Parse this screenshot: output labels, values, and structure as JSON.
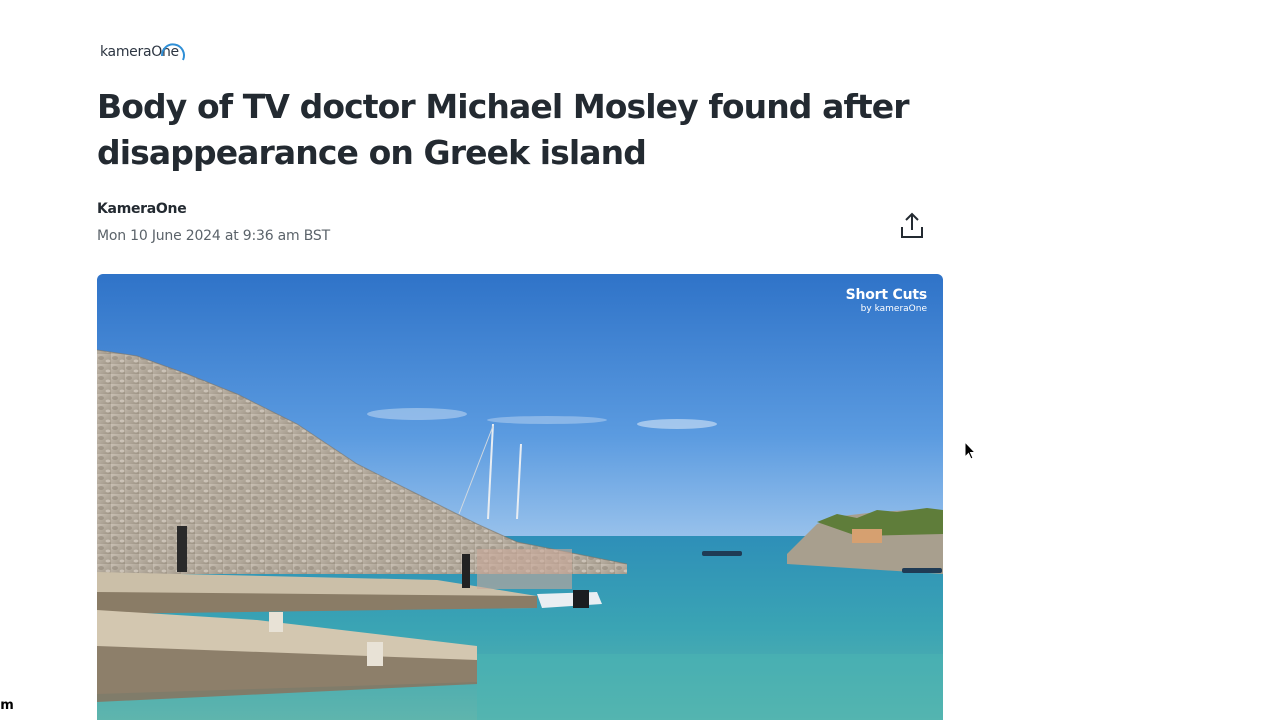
{
  "brand": {
    "logo_text": "kameraOne"
  },
  "article": {
    "headline": "Body of TV doctor Michael Mosley found after disappearance on Greek island",
    "author": "KameraOne",
    "timestamp": "Mon 10 June 2024 at 9:36 am BST"
  },
  "toolbar": {
    "share_icon": "share-icon"
  },
  "media": {
    "watermark_title": "Short Cuts",
    "watermark_subtitle": "by kameraOne",
    "colors": {
      "sky": "#3d82d2",
      "sea": "#3aa4b4",
      "rock": "#b9aea0"
    }
  },
  "corner_badge": "m"
}
